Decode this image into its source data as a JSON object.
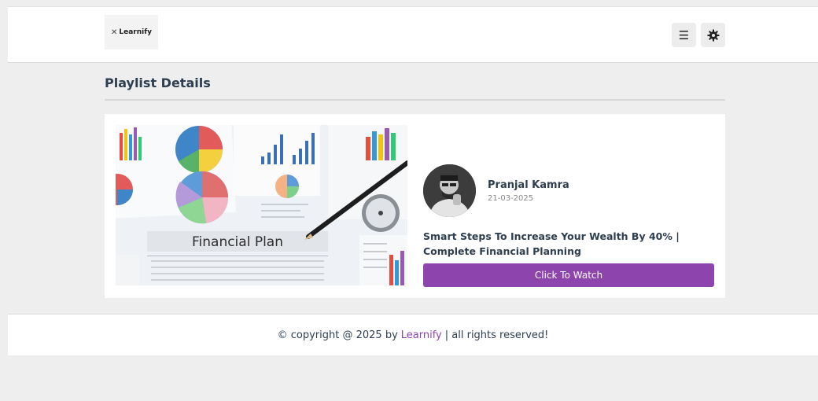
{
  "header": {
    "logo_text": "Learnify",
    "menu_icon": "menu-icon",
    "settings_icon": "gear-icon"
  },
  "page": {
    "title": "Playlist Details"
  },
  "playlist": {
    "thumbnail_caption": "Financial Plan",
    "author_name": "Pranjal Kamra",
    "date": "21-03-2025",
    "video_title": "Smart Steps To Increase Your Wealth By 40% | Complete Financial Planning",
    "watch_label": "Click To Watch"
  },
  "footer": {
    "prefix": "© copyright @ 2025 by",
    "brand": "Learnify",
    "suffix": "| all rights reserved!"
  },
  "colors": {
    "accent": "#8e44ad",
    "background": "#eeeeee",
    "card": "#ffffff",
    "text": "#2c3e50"
  }
}
